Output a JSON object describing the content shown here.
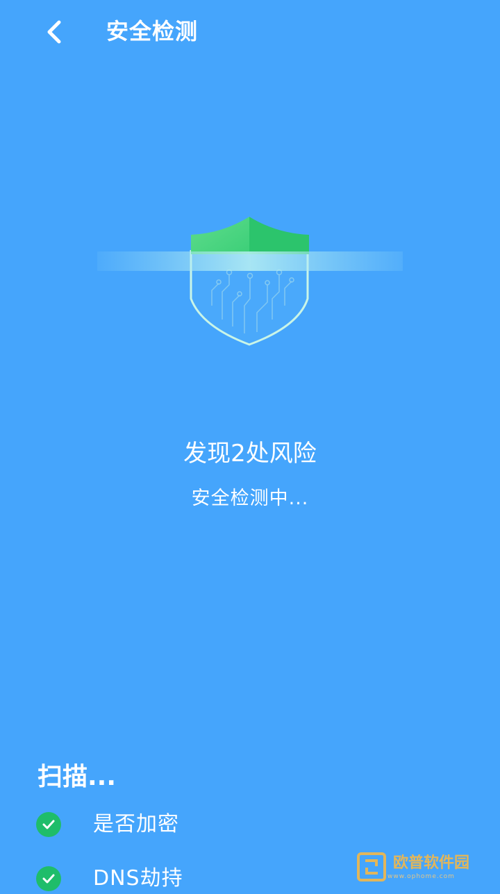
{
  "header": {
    "title": "安全检测",
    "back_icon": "chevron-left-icon"
  },
  "scan_visual": {
    "icon": "shield-icon",
    "colors": {
      "background": "#45a5fc",
      "shield_top": "#2fcc73",
      "shield_outline": "#c9f5e7",
      "scan_beam": "#9fe2f5"
    }
  },
  "status": {
    "headline": "发现2处风险",
    "subtext": "安全检测中..."
  },
  "scan": {
    "heading": "扫描...",
    "items": [
      {
        "label": "是否加密",
        "icon": "check-circle-icon",
        "status": "done"
      },
      {
        "label": "DNS劫持",
        "icon": "check-circle-icon",
        "status": "done"
      }
    ]
  },
  "watermark": {
    "text": "欧普软件园",
    "subtext": "www.ophome.com"
  }
}
